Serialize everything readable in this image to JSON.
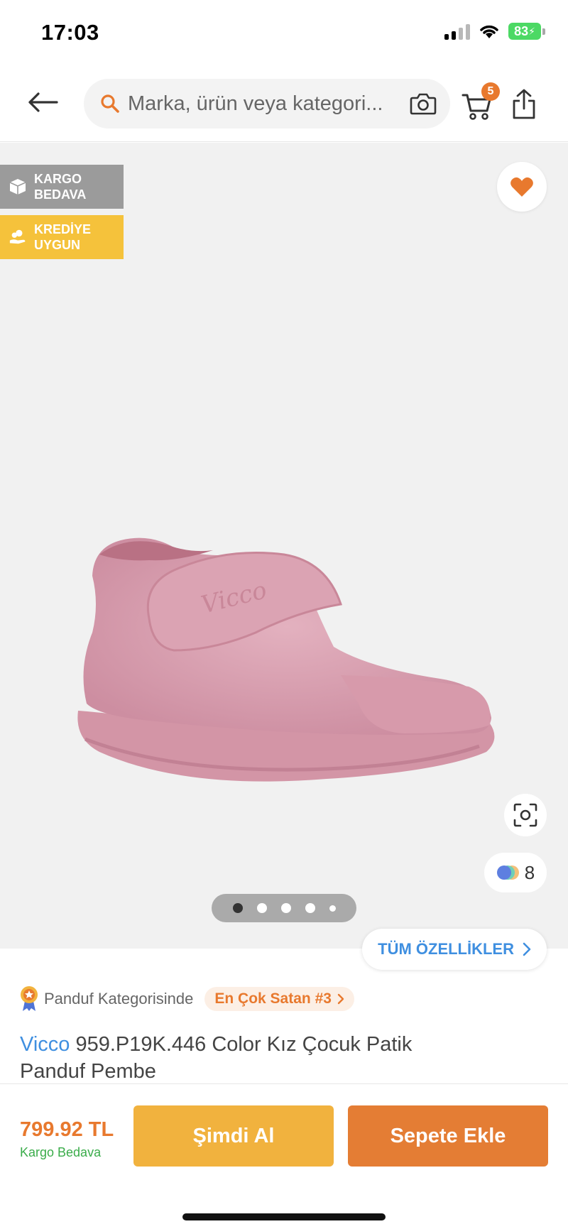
{
  "status_bar": {
    "time": "17:03",
    "battery": "83"
  },
  "header": {
    "search_placeholder": "Marka, ürün veya kategori...",
    "cart_count": "5",
    "accent_color": "#e8792e"
  },
  "gallery": {
    "badges": [
      {
        "label": "KARGO\nBEDAVA",
        "icon": "box-icon"
      },
      {
        "label": "KREDİYE\nUYGUN",
        "icon": "hand-coin-icon"
      }
    ],
    "color_variants": "8",
    "slide_count": 5,
    "active_slide": 1,
    "favorited": true
  },
  "features_button": "TÜM ÖZELLİKLER",
  "product": {
    "category_rank_label": "Panduf Kategorisinde",
    "rank_pill": "En Çok Satan #3",
    "brand": "Vicco",
    "title": " 959.P19K.446 Color Kız Çocuk Patik Panduf Pembe"
  },
  "bottom_bar": {
    "price": "799.92 TL",
    "shipping": "Kargo Bedava",
    "buy_now": "Şimdi Al",
    "add_to_cart": "Sepete Ekle"
  }
}
